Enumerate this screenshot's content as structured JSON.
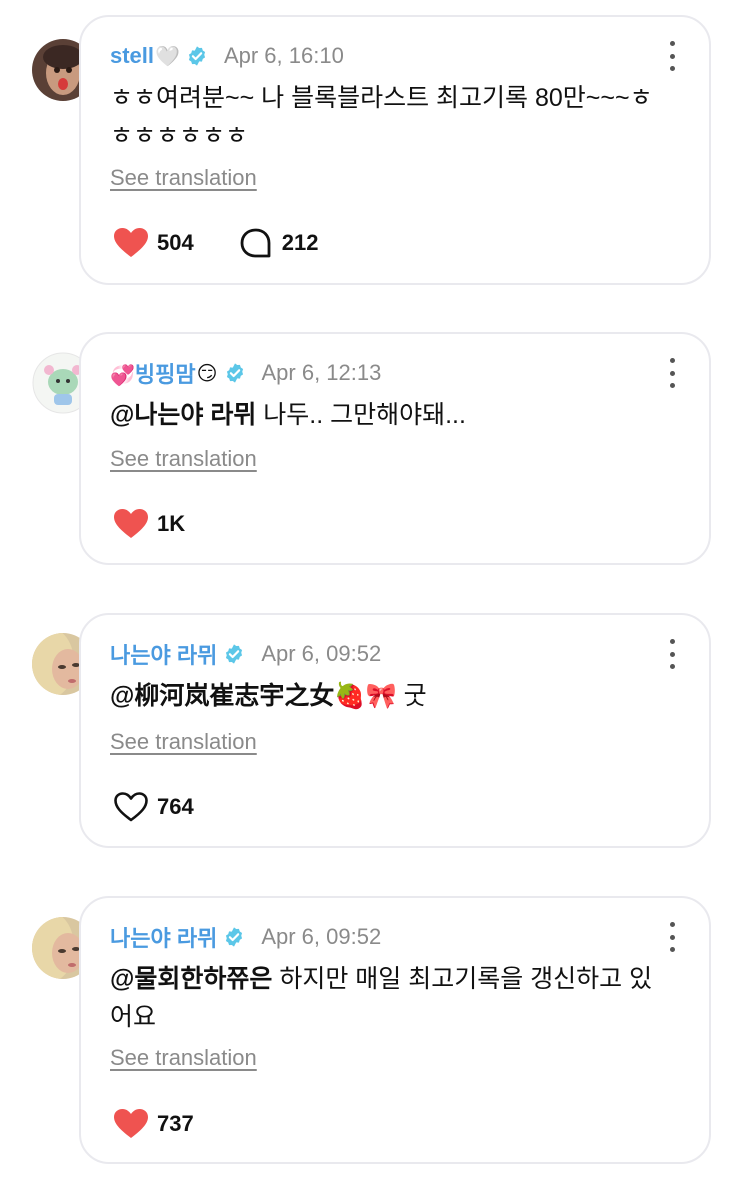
{
  "comments": [
    {
      "author": "stell",
      "author_emoji": "🤍",
      "time": "Apr 6, 16:10",
      "mention": "",
      "text_lines": [
        "ㅎㅎ여려분~~ 나 블록블라스트 최고기록 80만~~~ㅎ",
        "ㅎㅎㅎㅎㅎㅎ"
      ],
      "translate_label": "See translation",
      "likes": "504",
      "liked": true,
      "replies": "212"
    },
    {
      "author_prefix_emoji": "💞",
      "author": "빙핑맘",
      "author_emoji": "😏",
      "time": "Apr 6, 12:13",
      "mention": "@나는야 라뮈",
      "text": " 나두.. 그만해야돼...",
      "translate_label": "See translation",
      "likes": "1K",
      "liked": true
    },
    {
      "author": "나는야 라뮈",
      "time": "Apr 6, 09:52",
      "mention": "@柳河岚崔志宇之女🍓🎀",
      "text": " 굿",
      "translate_label": "See translation",
      "likes": "764",
      "liked": false
    },
    {
      "author": "나는야 라뮈",
      "time": "Apr 6, 09:52",
      "mention": "@물회한하쮸은",
      "text": " 하지만 매일 최고기록을 갱신하고 있",
      "text_line2": "어요",
      "translate_label": "See translation",
      "likes": "737",
      "liked": true
    }
  ],
  "colors": {
    "author_name": "#4a9ae0",
    "verified_badge": "#5cc7e8",
    "heart_liked": "#ef5350",
    "meta_gray": "#8a8a8a",
    "card_border": "#e9e9ee"
  },
  "icons": {
    "verified": "verified-badge-icon",
    "more": "more-vertical-icon",
    "like": "heart-icon",
    "reply": "speech-bubble-icon"
  }
}
